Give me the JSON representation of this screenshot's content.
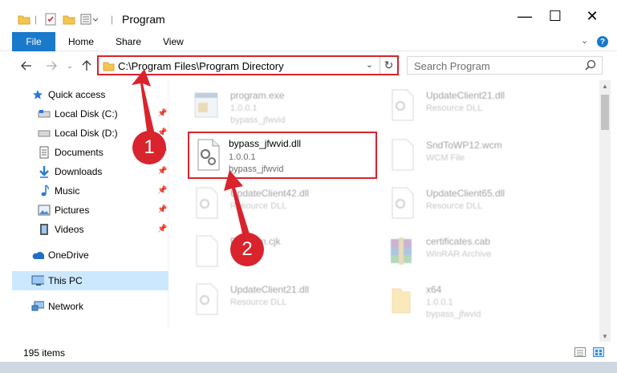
{
  "window": {
    "title": "Program",
    "minimize": "—",
    "maximize": "☐",
    "close": "✕"
  },
  "ribbon": {
    "tabs": [
      "File",
      "Home",
      "Share",
      "View"
    ],
    "help": "?"
  },
  "address_bar": {
    "path": "C:\\Program Files\\Program Directory"
  },
  "search": {
    "placeholder": "Search Program"
  },
  "sidebar": {
    "items": [
      {
        "label": "Quick access",
        "icon": "star-icon",
        "pinned": false
      },
      {
        "label": "Local Disk (C:)",
        "icon": "drive-icon",
        "pinned": true
      },
      {
        "label": "Local Disk (D:)",
        "icon": "drive-icon",
        "pinned": true
      },
      {
        "label": "Documents",
        "icon": "documents-icon",
        "pinned": true
      },
      {
        "label": "Downloads",
        "icon": "download-icon",
        "pinned": true
      },
      {
        "label": "Music",
        "icon": "music-icon",
        "pinned": true
      },
      {
        "label": "Pictures",
        "icon": "pictures-icon",
        "pinned": true
      },
      {
        "label": "Videos",
        "icon": "videos-icon",
        "pinned": true
      },
      {
        "label": "OneDrive",
        "icon": "cloud-icon",
        "pinned": false
      },
      {
        "label": "This PC",
        "icon": "computer-icon",
        "pinned": false,
        "selected": true
      },
      {
        "label": "Network",
        "icon": "network-icon",
        "pinned": false
      }
    ]
  },
  "files": [
    {
      "name": "program.exe",
      "line2": "1.0.0.1",
      "line3": "bypass_jfwvid",
      "kind": "exe",
      "highlighted": false
    },
    {
      "name": "UpdateClient21.dll",
      "line2": "Resource DLL",
      "line3": "",
      "kind": "dll",
      "highlighted": false
    },
    {
      "name": "bypass_jfwvid.dll",
      "line2": "1.0.0.1",
      "line3": "bypass_jfwvid",
      "kind": "dll",
      "highlighted": true
    },
    {
      "name": "SndToWP12.wcm",
      "line2": "WCM File",
      "line3": "",
      "kind": "blank",
      "highlighted": false
    },
    {
      "name": "UpdateClient42.dll",
      "line2": "Resource DLL",
      "line3": "",
      "kind": "dll",
      "highlighted": false
    },
    {
      "name": "UpdateClient65.dll",
      "line2": "Resource DLL",
      "line3": "",
      "kind": "dll",
      "highlighted": false
    },
    {
      "name": "Fanform.cjk",
      "line2": "",
      "line3": "",
      "kind": "blank",
      "highlighted": false
    },
    {
      "name": "certificates.cab",
      "line2": "WinRAR Archive",
      "line3": "",
      "kind": "archive",
      "highlighted": false
    },
    {
      "name": "UpdateClient21.dll",
      "line2": "Resource DLL",
      "line3": "",
      "kind": "dll",
      "highlighted": false
    },
    {
      "name": "x64",
      "line2": "1.0.0.1",
      "line3": "bypass_jfwvid",
      "kind": "folder",
      "highlighted": false
    }
  ],
  "status": {
    "item_count": "195 items"
  },
  "annotations": {
    "step1": "1",
    "step2": "2",
    "color": "#d9232d"
  },
  "colors": {
    "accent": "#1979ca",
    "selected_bg": "#cce8ff",
    "highlight_border": "#d9232d"
  }
}
